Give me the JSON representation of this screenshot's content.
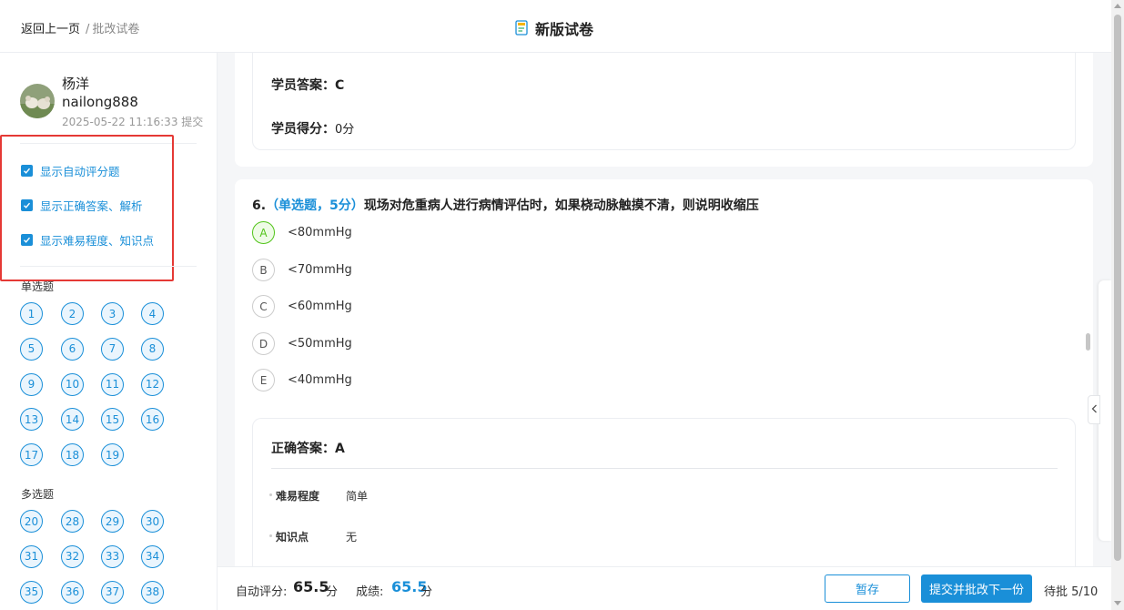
{
  "breadcrumb": {
    "back": "返回上一页",
    "separator": "/",
    "current": "批改试卷"
  },
  "header": {
    "title": "新版试卷"
  },
  "student": {
    "name": "杨洋",
    "id": "nailong888",
    "submitted": "2025-05-22 11:16:33 提交"
  },
  "options": [
    {
      "label": "显示自动评分题",
      "checked": true
    },
    {
      "label": "显示正确答案、解析",
      "checked": true
    },
    {
      "label": "显示难易程度、知识点",
      "checked": true
    }
  ],
  "sections": {
    "single": {
      "label": "单选题",
      "numbers": [
        "1",
        "2",
        "3",
        "4",
        "5",
        "6",
        "7",
        "8",
        "9",
        "10",
        "11",
        "12",
        "13",
        "14",
        "15",
        "16",
        "17",
        "18",
        "19"
      ]
    },
    "multi": {
      "label": "多选题",
      "numbers": [
        "20",
        "28",
        "29",
        "30",
        "31",
        "32",
        "33",
        "34",
        "35",
        "36",
        "37",
        "38"
      ]
    }
  },
  "prev_question": {
    "answer_label": "学员答案：",
    "answer_value": "C",
    "score_label": "学员得分：",
    "score_value": "0分"
  },
  "question": {
    "number": "6.",
    "meta": "（单选题，5分）",
    "text": "现场对危重病人进行病情评估时，如果桡动脉触摸不清，则说明收缩压",
    "choices": [
      {
        "key": "A",
        "text": "<80mmHg",
        "correct": true
      },
      {
        "key": "B",
        "text": "<70mmHg",
        "correct": false
      },
      {
        "key": "C",
        "text": "<60mmHg",
        "correct": false
      },
      {
        "key": "D",
        "text": "<50mmHg",
        "correct": false
      },
      {
        "key": "E",
        "text": "<40mmHg",
        "correct": false
      }
    ],
    "correct_label": "正确答案：",
    "correct_value": "A",
    "difficulty_label": "难易程度",
    "difficulty_value": "简单",
    "knowledge_label": "知识点",
    "knowledge_value": "无"
  },
  "footer": {
    "auto_label": "自动评分:",
    "auto_value": "65.5",
    "auto_unit": "分",
    "score_label": "成绩:",
    "score_value": "65.5",
    "score_unit": "分",
    "save_label": "暂存",
    "submit_label": "提交并批改下一份",
    "pending": "待批 5/10"
  },
  "colors": {
    "accent": "#1a8fd8",
    "correct": "#52c41a",
    "highlight_box": "#e53935"
  },
  "icons": {
    "title": "exam-paper-icon",
    "checkbox": "check-icon",
    "drawer": "chevron-left-icon"
  }
}
